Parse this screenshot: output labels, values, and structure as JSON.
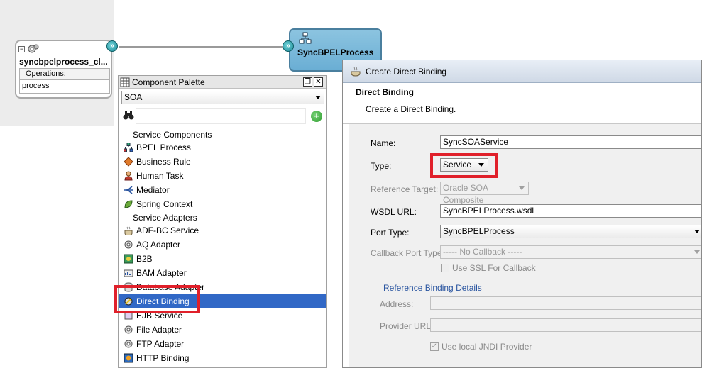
{
  "composite": {
    "component_title": "syncbpelprocess_cl...",
    "operations_header": "Operations:",
    "operation": "process",
    "bpel_title": "SyncBPELProcess"
  },
  "palette": {
    "title": "Component Palette",
    "combo_value": "SOA",
    "sections": {
      "components": "Service Components",
      "adapters": "Service Adapters"
    },
    "items": [
      {
        "label": "BPEL Process",
        "icon": "bpel-process-icon"
      },
      {
        "label": "Business Rule",
        "icon": "business-rule-icon"
      },
      {
        "label": "Human Task",
        "icon": "human-task-icon"
      },
      {
        "label": "Mediator",
        "icon": "mediator-icon"
      },
      {
        "label": "Spring Context",
        "icon": "spring-context-icon"
      }
    ],
    "adapters": [
      {
        "label": "ADF-BC Service",
        "icon": "adf-bc-icon"
      },
      {
        "label": "AQ Adapter",
        "icon": "aq-adapter-icon"
      },
      {
        "label": "B2B",
        "icon": "b2b-icon"
      },
      {
        "label": "BAM Adapter",
        "icon": "bam-adapter-icon"
      },
      {
        "label": "Database Adapter",
        "icon": "database-adapter-icon"
      },
      {
        "label": "Direct Binding",
        "icon": "direct-binding-icon"
      },
      {
        "label": "EJB Service",
        "icon": "ejb-service-icon"
      },
      {
        "label": "File Adapter",
        "icon": "file-adapter-icon"
      },
      {
        "label": "FTP Adapter",
        "icon": "ftp-adapter-icon"
      },
      {
        "label": "HTTP Binding",
        "icon": "http-binding-icon"
      }
    ],
    "selected": "Direct Binding"
  },
  "dialog": {
    "title": "Create Direct Binding",
    "header_title": "Direct Binding",
    "header_desc": "Create a Direct Binding.",
    "name_label": "Name:",
    "name_value": "SyncSOAService",
    "type_label": "Type:",
    "type_value": "Service",
    "ref_target_label": "Reference Target:",
    "ref_target_value": "Oracle SOA Composite",
    "wsdl_label": "WSDL URL:",
    "wsdl_value": "SyncBPELProcess.wsdl",
    "port_label": "Port Type:",
    "port_value": "SyncBPELProcess",
    "callback_label": "Callback Port Type:",
    "callback_value": "----- No Callback -----",
    "ssl_label": "Use SSL For Callback",
    "group_legend": "Reference Binding Details",
    "address_label": "Address:",
    "provider_label": "Provider URL:",
    "jndi_label": "Use local JNDI Provider"
  },
  "colors": {
    "highlight": "#e0202a",
    "selection": "#3168c6",
    "bpel_fill": "#7ab8da"
  }
}
